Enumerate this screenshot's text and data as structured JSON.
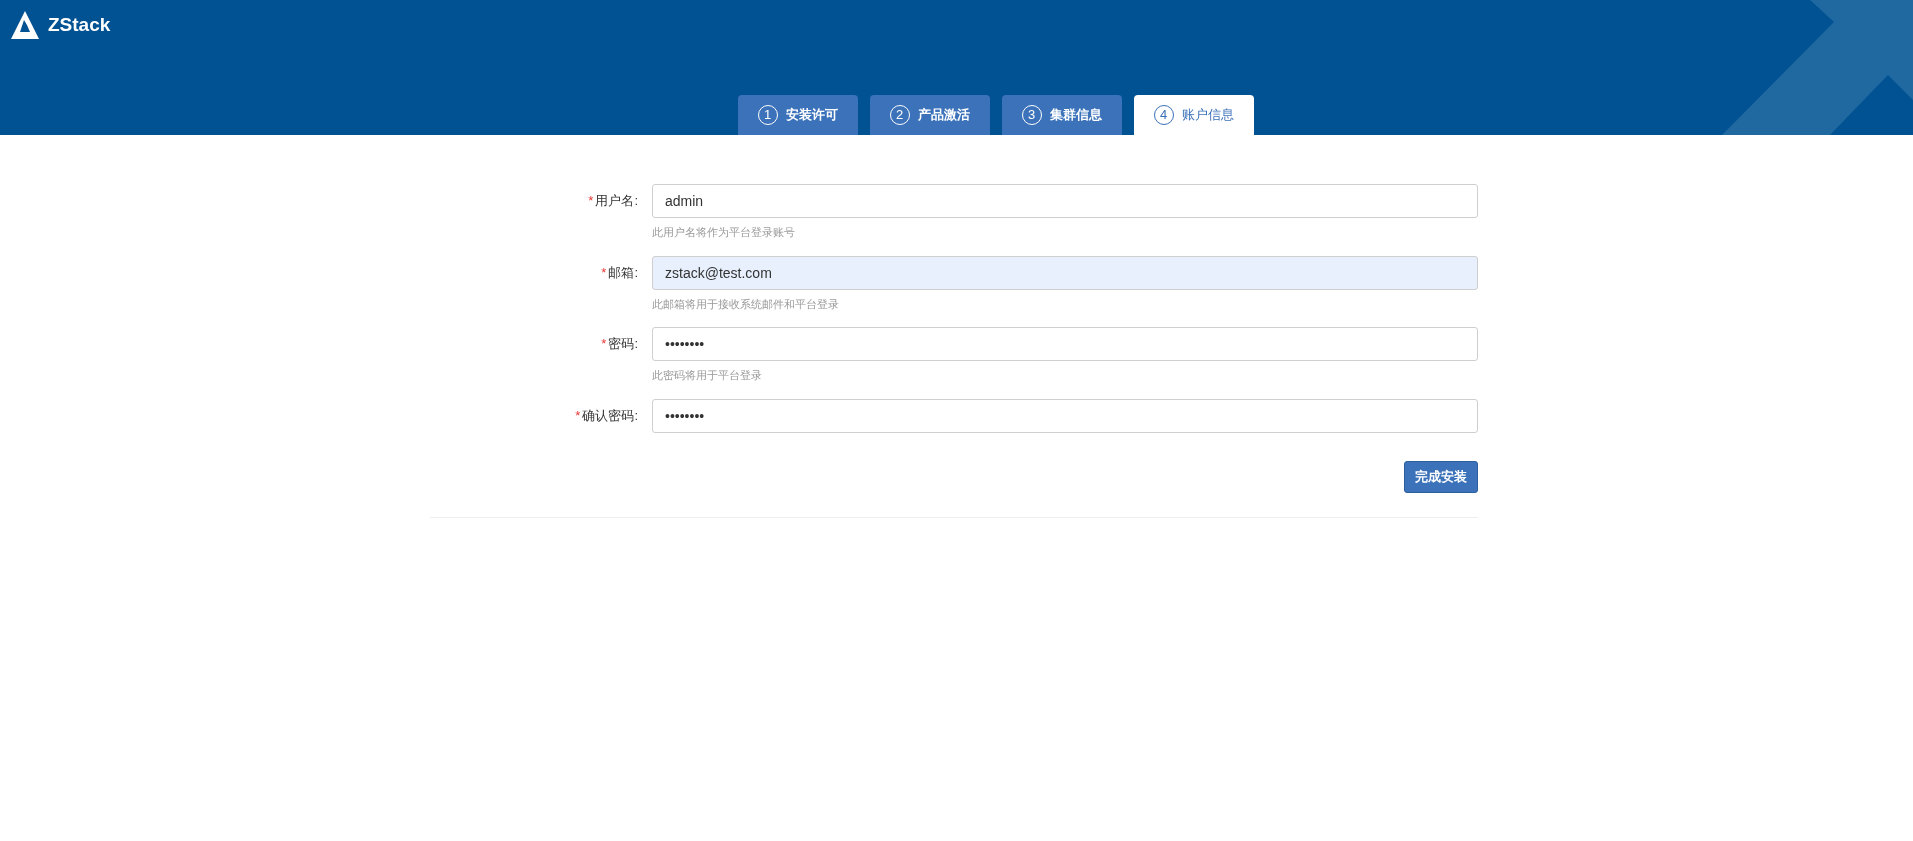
{
  "header": {
    "logo_text": "ZStack"
  },
  "tabs": [
    {
      "number": "1",
      "label": "安装许可",
      "selected": false
    },
    {
      "number": "2",
      "label": "产品激活",
      "selected": false
    },
    {
      "number": "3",
      "label": "集群信息",
      "selected": false
    },
    {
      "number": "4",
      "label": "账户信息",
      "selected": true
    }
  ],
  "form": {
    "fields": [
      {
        "label": "用户名:",
        "required_mark": "*",
        "value": "admin",
        "hint": "此用户名将作为平台登录账号",
        "autofilled": false
      },
      {
        "label": "邮箱:",
        "required_mark": "*",
        "value": "zstack@test.com",
        "hint": "此邮箱将用于接收系统邮件和平台登录",
        "autofilled": true
      },
      {
        "label": "密码:",
        "required_mark": "*",
        "value": "••••••••",
        "hint": "此密码将用于平台登录",
        "autofilled": false
      },
      {
        "label": "确认密码:",
        "required_mark": "*",
        "value": "••••••••",
        "autofilled": false
      }
    ],
    "submit": "完成安装"
  }
}
